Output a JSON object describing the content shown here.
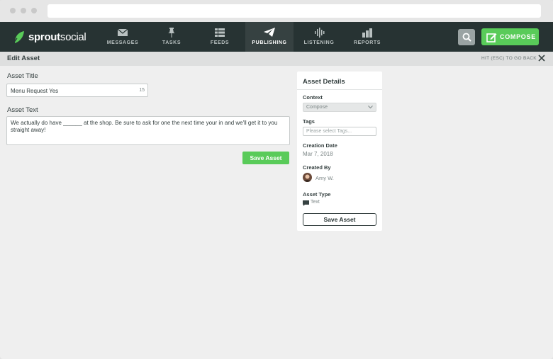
{
  "nav": {
    "brand_bold": "sprout",
    "brand_regular": "social",
    "items": [
      {
        "label": "MESSAGES",
        "icon": "envelope-icon"
      },
      {
        "label": "TASKS",
        "icon": "pin-icon"
      },
      {
        "label": "FEEDS",
        "icon": "list-icon"
      },
      {
        "label": "PUBLISHING",
        "icon": "paper-plane-icon",
        "active": true
      },
      {
        "label": "LISTENING",
        "icon": "soundwave-icon"
      },
      {
        "label": "REPORTS",
        "icon": "bar-chart-icon"
      }
    ],
    "compose_label": "COMPOSE"
  },
  "subbar": {
    "title": "Edit Asset",
    "esc_hint": "HIT (ESC) TO GO BACK"
  },
  "form": {
    "title_label": "Asset Title",
    "title_value": "Menu Request Yes",
    "title_count": "15",
    "text_label": "Asset Text",
    "text_value": "We actually do have ______ at the shop. Be sure to ask for one the next time your in and we'll get it to you straight away!",
    "save_label": "Save Asset"
  },
  "details": {
    "heading": "Asset Details",
    "context_label": "Context",
    "context_value": "Compose",
    "tags_label": "Tags",
    "tags_placeholder": "Please select Tags...",
    "created_date_label": "Creation Date",
    "created_date_value": "Mar 7, 2018",
    "created_by_label": "Created By",
    "created_by_value": "Amy W.",
    "type_label": "Asset Type",
    "type_value": "Text",
    "save_label": "Save Asset"
  },
  "colors": {
    "nav_bg": "#273333",
    "nav_active": "#364141",
    "accent_green": "#59cb59"
  }
}
